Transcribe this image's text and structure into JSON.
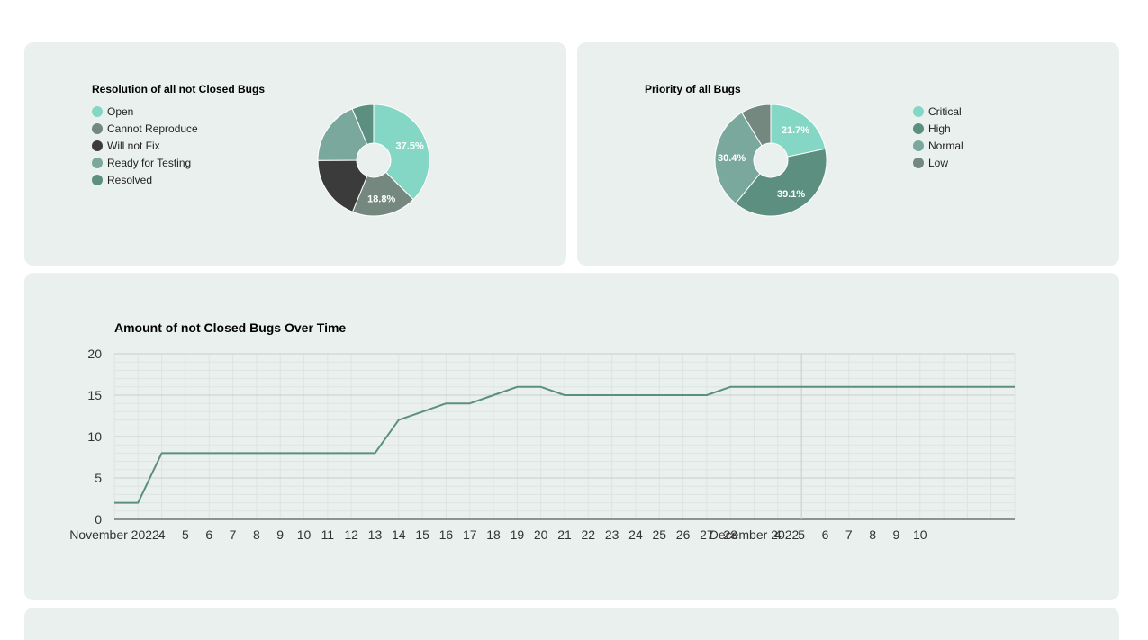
{
  "colors": {
    "panel_bg": "#eaf0ed",
    "line": "#5c8f7f",
    "grid_major": "#c8cfcc",
    "grid_minor": "#dde5e1",
    "slice_label": "#ffffff"
  },
  "chart_data": [
    {
      "type": "pie",
      "donut": true,
      "title": "Resolution of all not Closed Bugs",
      "legend_position": "left",
      "categories": [
        "Open",
        "Cannot Reproduce",
        "Will not Fix",
        "Ready for Testing",
        "Resolved"
      ],
      "values": [
        37.5,
        18.8,
        18.8,
        18.8,
        6.3
      ],
      "value_labels": [
        "37.5%",
        "18.8%",
        "",
        "",
        ""
      ],
      "colors": [
        "#84d7c4",
        "#748880",
        "#3b3b3b",
        "#7aa89c",
        "#5c8f7f"
      ]
    },
    {
      "type": "pie",
      "donut": true,
      "title": "Priority of all Bugs",
      "legend_position": "right",
      "categories": [
        "Critical",
        "High",
        "Normal",
        "Low"
      ],
      "values": [
        21.7,
        39.1,
        30.4,
        8.7
      ],
      "value_labels": [
        "21.7%",
        "39.1%",
        "30.4%",
        ""
      ],
      "colors": [
        "#84d7c4",
        "#5c8f7f",
        "#7aa89c",
        "#748880"
      ]
    },
    {
      "type": "line",
      "title": "Amount of not Closed Bugs Over Time",
      "xlabel": "",
      "ylabel": "",
      "ylim": [
        0,
        20
      ],
      "yticks": [
        0,
        5,
        10,
        15,
        20
      ],
      "grid": true,
      "x_tick_labels": [
        "November 2022",
        "4",
        "5",
        "6",
        "7",
        "8",
        "9",
        "10",
        "11",
        "12",
        "13",
        "14",
        "15",
        "16",
        "17",
        "18",
        "19",
        "20",
        "21",
        "22",
        "23",
        "24",
        "25",
        "26",
        "27",
        "28",
        "December 2022",
        "4",
        "5",
        "6",
        "7",
        "8",
        "9",
        "10"
      ],
      "series": [
        {
          "x": [
            "2022-11-02",
            "2022-11-03",
            "2022-11-04",
            "2022-11-05",
            "2022-11-06",
            "2022-11-07",
            "2022-11-08",
            "2022-11-09",
            "2022-11-10",
            "2022-11-11",
            "2022-11-12",
            "2022-11-13",
            "2022-11-14",
            "2022-11-15",
            "2022-11-16",
            "2022-11-17",
            "2022-11-18",
            "2022-11-19",
            "2022-11-20",
            "2022-11-21",
            "2022-11-22",
            "2022-11-23",
            "2022-11-24",
            "2022-11-25",
            "2022-11-26",
            "2022-11-27",
            "2022-11-28",
            "2022-11-29",
            "2022-11-30",
            "2022-12-01",
            "2022-12-02",
            "2022-12-03",
            "2022-12-04",
            "2022-12-05",
            "2022-12-06",
            "2022-12-07",
            "2022-12-08",
            "2022-12-09",
            "2022-12-10"
          ],
          "y": [
            2,
            2,
            8,
            8,
            8,
            8,
            8,
            8,
            8,
            8,
            8,
            8,
            12,
            13,
            14,
            14,
            15,
            16,
            16,
            15,
            15,
            15,
            15,
            15,
            15,
            15,
            16,
            16,
            16,
            16,
            16,
            16,
            16,
            16,
            16,
            16,
            16,
            16,
            16
          ]
        }
      ]
    }
  ]
}
